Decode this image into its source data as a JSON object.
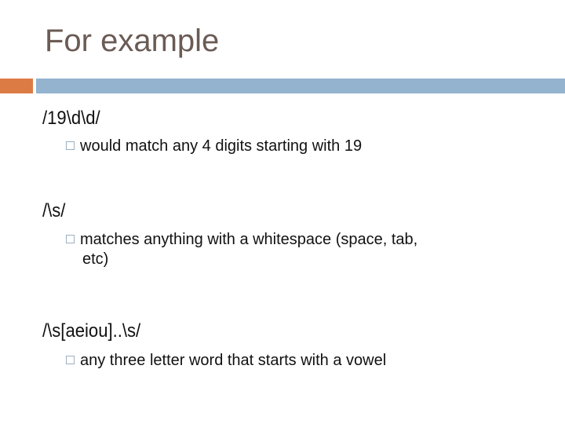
{
  "slide": {
    "title": "For example",
    "colors": {
      "title_text": "#6b5b55",
      "accent_orange": "#dd7b45",
      "accent_blue": "#93b3cf",
      "bullet_border": "#9bb0c1",
      "body_text": "#111111"
    },
    "bullet_icon": "hollow-square",
    "items": [
      {
        "pattern": "/19\\d\\d/",
        "description": "would match any 4 digits starting with 19"
      },
      {
        "pattern": "/\\s/",
        "description": "matches anything with a whitespace (space, tab,",
        "description_cont": "etc)"
      },
      {
        "pattern": "/\\s[aeiou]..\\s/",
        "description": "any three letter word that starts with a vowel"
      }
    ]
  }
}
